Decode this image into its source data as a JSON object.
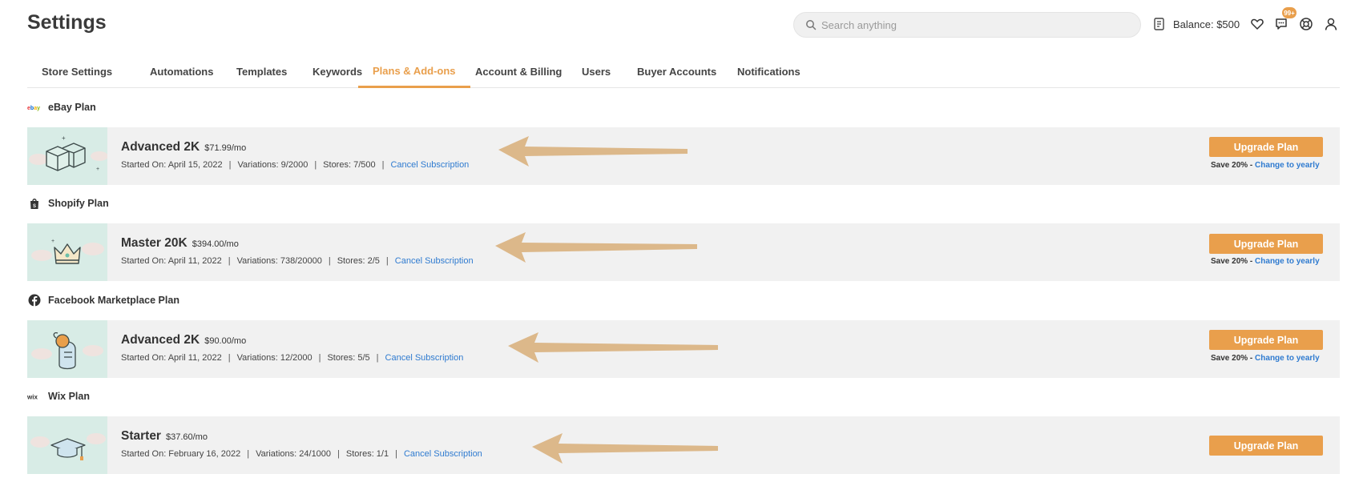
{
  "header": {
    "title": "Settings",
    "search_placeholder": "Search anything",
    "balance_label": "Balance: $500",
    "notification_badge": "99+"
  },
  "tabs": [
    {
      "label": "Store Settings",
      "active": false
    },
    {
      "label": "Automations",
      "active": false
    },
    {
      "label": "Templates",
      "active": false
    },
    {
      "label": "Keywords",
      "active": false
    },
    {
      "label": "Plans & Add-ons",
      "active": true
    },
    {
      "label": "Account & Billing",
      "active": false
    },
    {
      "label": "Users",
      "active": false
    },
    {
      "label": "Buyer Accounts",
      "active": false
    },
    {
      "label": "Notifications",
      "active": false
    }
  ],
  "plans": [
    {
      "section": "eBay Plan",
      "platform_logo": "ebay",
      "name": "Advanced 2K",
      "price": "$71.99/mo",
      "started": "Started On: April 15, 2022",
      "variations": "Variations: 9/2000",
      "stores": "Stores: 7/500",
      "cancel_label": "Cancel Subscription",
      "upgrade_label": "Upgrade Plan",
      "save_label": "Save 20% -",
      "change_label": "Change to yearly"
    },
    {
      "section": "Shopify Plan",
      "platform_logo": "shopify-bag-icon",
      "name": "Master 20K",
      "price": "$394.00/mo",
      "started": "Started On: April 11, 2022",
      "variations": "Variations: 738/20000",
      "stores": "Stores: 2/5",
      "cancel_label": "Cancel Subscription",
      "upgrade_label": "Upgrade Plan",
      "save_label": "Save 20% -",
      "change_label": "Change to yearly"
    },
    {
      "section": "Facebook Marketplace Plan",
      "platform_logo": "facebook-icon",
      "name": "Advanced 2K",
      "price": "$90.00/mo",
      "started": "Started On: April 11, 2022",
      "variations": "Variations: 12/2000",
      "stores": "Stores: 5/5",
      "cancel_label": "Cancel Subscription",
      "upgrade_label": "Upgrade Plan",
      "save_label": "Save 20% -",
      "change_label": "Change to yearly"
    },
    {
      "section": "Wix Plan",
      "platform_logo": "wix",
      "name": "Starter",
      "price": "$37.60/mo",
      "started": "Started On: February 16, 2022",
      "variations": "Variations: 24/1000",
      "stores": "Stores: 1/1",
      "cancel_label": "Cancel Subscription",
      "upgrade_label": "Upgrade Plan"
    }
  ],
  "colors": {
    "accent": "#e99f4c",
    "link": "#2f7bd0",
    "card_bg": "#f1f1f1",
    "thumb_bg": "#d8ece6",
    "arrow": "#dcb88a"
  }
}
